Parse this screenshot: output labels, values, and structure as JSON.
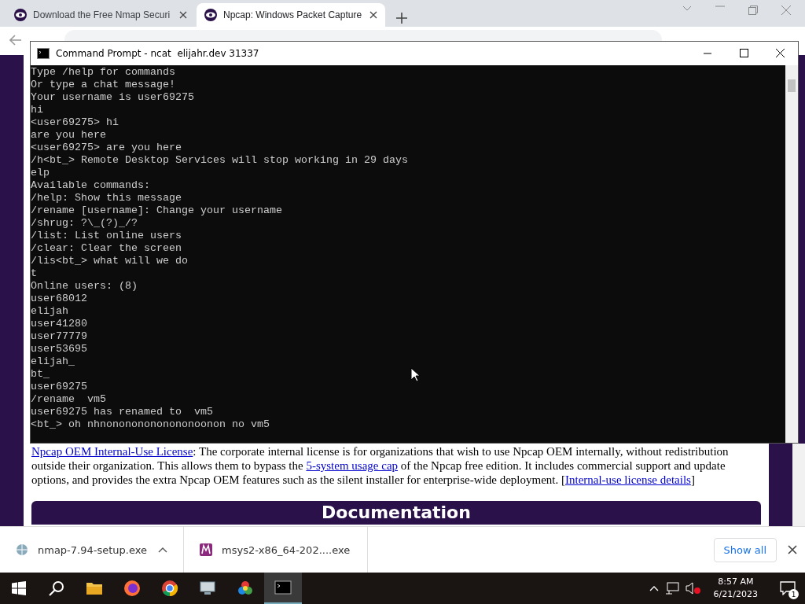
{
  "browser": {
    "tabs": [
      {
        "title": "Download the Free Nmap Securi",
        "selected": false
      },
      {
        "title": "Npcap: Windows Packet Capture",
        "selected": true
      }
    ],
    "page": {
      "paragraph": [
        {
          "kind": "link",
          "text": "Npcap OEM Internal-Use License"
        },
        {
          "kind": "text",
          "text": ": The corporate internal license is for organizations that wish to use Npcap OEM internally, without redistribution outside their organization. This allows them to bypass the "
        },
        {
          "kind": "link",
          "text": "5-system usage cap"
        },
        {
          "kind": "text",
          "text": " of the Npcap free edition. It includes commercial support and update options, and provides the extra Npcap OEM features such as the silent installer for enterprise-wide deployment. ["
        },
        {
          "kind": "link",
          "text": "Internal-use license details"
        },
        {
          "kind": "text",
          "text": "]"
        }
      ],
      "section_heading": "Documentation"
    },
    "downloads": [
      {
        "file": "nmap-7.94-setup.exe",
        "kind": "globe"
      },
      {
        "file": "msys2-x86_64-202....exe",
        "kind": "msys"
      }
    ],
    "show_all": "Show all"
  },
  "console": {
    "title": "Command Prompt - ncat  elijahr.dev 31337",
    "lines": [
      "Type /help for commands",
      "Or type a chat message!",
      "Your username is user69275",
      "hi",
      "<user69275> hi",
      "are you here",
      "<user69275> are you here",
      "/h<bt_> Remote Desktop Services will stop working in 29 days",
      "elp",
      "Available commands:",
      "/help: Show this message",
      "/rename [username]: Change your username",
      "/shrug: ?\\_(?)_/?",
      "/list: List online users",
      "/clear: Clear the screen",
      "/lis<bt_> what will we do",
      "t",
      "Online users: (8)",
      "user68012",
      "elijah",
      "user41280",
      "user77779",
      "user53695",
      "elijah_",
      "bt_",
      "user69275",
      "/rename  vm5",
      "user69275 has renamed to  vm5",
      "<bt_> oh nhnonononononononoonon no vm5"
    ]
  },
  "taskbar": {
    "apps": [
      {
        "kind": "folder",
        "active": false
      },
      {
        "kind": "firefox",
        "active": false
      },
      {
        "kind": "chrome",
        "active": false
      },
      {
        "kind": "monitor",
        "active": false
      },
      {
        "kind": "wheel",
        "active": false
      },
      {
        "kind": "terminal",
        "active": true
      }
    ],
    "time": "8:57 AM",
    "date": "6/21/2023",
    "notifications": "1"
  }
}
